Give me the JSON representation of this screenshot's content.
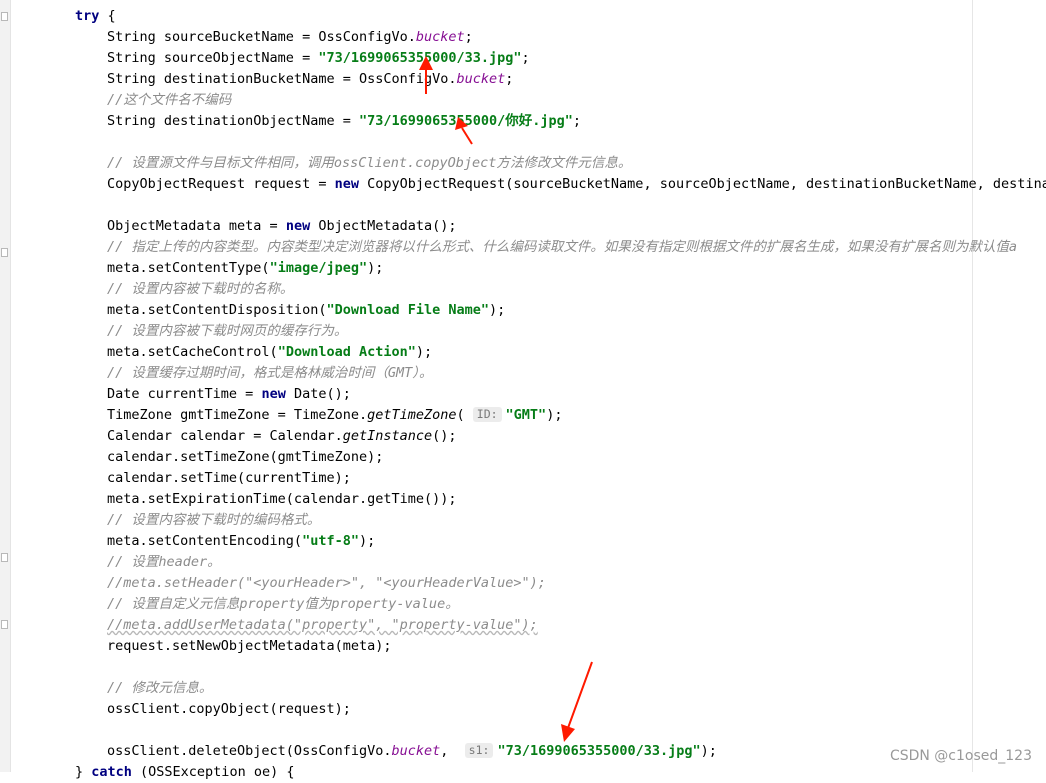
{
  "editor": {
    "top_line_fragment": "();  ... ( ... ) ... ) ... ));",
    "lines": [
      {
        "indent": 0,
        "t": [
          {
            "k": "kw",
            "v": "try"
          },
          {
            "v": " {"
          }
        ]
      },
      {
        "indent": 1,
        "t": [
          {
            "v": "String sourceBucketName = OssConfigVo."
          },
          {
            "k": "fld",
            "v": "bucket"
          },
          {
            "v": ";"
          }
        ]
      },
      {
        "indent": 1,
        "t": [
          {
            "v": "String sourceObjectName = "
          },
          {
            "k": "st",
            "v": "\"73/1699065355000/33.jpg\""
          },
          {
            "v": ";"
          }
        ]
      },
      {
        "indent": 1,
        "t": [
          {
            "v": "String destinationBucketName = OssConfigVo."
          },
          {
            "k": "fld",
            "v": "bucket"
          },
          {
            "v": ";"
          }
        ]
      },
      {
        "indent": 1,
        "t": [
          {
            "k": "cm",
            "v": "//这个文件名不编码"
          }
        ]
      },
      {
        "indent": 1,
        "t": [
          {
            "v": "String destinationObjectName = "
          },
          {
            "k": "st",
            "v": "\"73/1699065355000/你好.jpg\""
          },
          {
            "v": ";"
          }
        ]
      },
      {
        "indent": 1,
        "t": []
      },
      {
        "indent": 1,
        "t": [
          {
            "k": "cm",
            "v": "// 设置源文件与目标文件相同，调用ossClient.copyObject方法修改文件元信息。"
          }
        ]
      },
      {
        "indent": 1,
        "t": [
          {
            "v": "CopyObjectRequest request = "
          },
          {
            "k": "kw",
            "v": "new"
          },
          {
            "v": " CopyObjectRequest(sourceBucketName, sourceObjectName, destinationBucketName, destinati"
          }
        ]
      },
      {
        "indent": 1,
        "t": []
      },
      {
        "indent": 1,
        "t": [
          {
            "v": "ObjectMetadata meta = "
          },
          {
            "k": "kw",
            "v": "new"
          },
          {
            "v": " ObjectMetadata();"
          }
        ]
      },
      {
        "indent": 1,
        "t": [
          {
            "k": "cm",
            "v": "// 指定上传的内容类型。内容类型决定浏览器将以什么形式、什么编码读取文件。如果没有指定则根据文件的扩展名生成，如果没有扩展名则为默认值a"
          }
        ]
      },
      {
        "indent": 1,
        "t": [
          {
            "v": "meta.setContentType("
          },
          {
            "k": "st",
            "v": "\"image/jpeg\""
          },
          {
            "v": ");"
          }
        ]
      },
      {
        "indent": 1,
        "t": [
          {
            "k": "cm",
            "v": "// 设置内容被下载时的名称。"
          }
        ]
      },
      {
        "indent": 1,
        "t": [
          {
            "v": "meta.setContentDisposition("
          },
          {
            "k": "st",
            "v": "\"Download File Name\""
          },
          {
            "v": ");"
          }
        ]
      },
      {
        "indent": 1,
        "t": [
          {
            "k": "cm",
            "v": "// 设置内容被下载时网页的缓存行为。"
          }
        ]
      },
      {
        "indent": 1,
        "t": [
          {
            "v": "meta.setCacheControl("
          },
          {
            "k": "st",
            "v": "\"Download Action\""
          },
          {
            "v": ");"
          }
        ]
      },
      {
        "indent": 1,
        "t": [
          {
            "k": "cm",
            "v": "// 设置缓存过期时间，格式是格林威治时间（GMT）。"
          }
        ]
      },
      {
        "indent": 1,
        "t": [
          {
            "v": "Date currentTime = "
          },
          {
            "k": "kw",
            "v": "new"
          },
          {
            "v": " Date();"
          }
        ]
      },
      {
        "indent": 1,
        "t": [
          {
            "v": "TimeZone gmtTimeZone = TimeZone."
          },
          {
            "k": "mth",
            "v": "getTimeZone"
          },
          {
            "v": "( "
          },
          {
            "k": "hint",
            "v": "ID:"
          },
          {
            "k": "st",
            "v": "\"GMT\""
          },
          {
            "v": ");"
          }
        ]
      },
      {
        "indent": 1,
        "t": [
          {
            "v": "Calendar calendar = Calendar."
          },
          {
            "k": "mth",
            "v": "getInstance"
          },
          {
            "v": "();"
          }
        ]
      },
      {
        "indent": 1,
        "t": [
          {
            "v": "calendar.setTimeZone(gmtTimeZone);"
          }
        ]
      },
      {
        "indent": 1,
        "t": [
          {
            "v": "calendar.setTime(currentTime);"
          }
        ]
      },
      {
        "indent": 1,
        "t": [
          {
            "v": "meta.setExpirationTime(calendar.getTime());"
          }
        ]
      },
      {
        "indent": 1,
        "t": [
          {
            "k": "cm",
            "v": "// 设置内容被下载时的编码格式。"
          }
        ]
      },
      {
        "indent": 1,
        "t": [
          {
            "v": "meta.setContentEncoding("
          },
          {
            "k": "st",
            "v": "\"utf-8\""
          },
          {
            "v": ");"
          }
        ]
      },
      {
        "indent": 1,
        "t": [
          {
            "k": "cm",
            "v": "// 设置header。"
          }
        ]
      },
      {
        "indent": 1,
        "t": [
          {
            "k": "cm",
            "v": "//meta.setHeader(\"<yourHeader>\", \"<yourHeaderValue>\");"
          }
        ]
      },
      {
        "indent": 1,
        "t": [
          {
            "k": "cm",
            "v": "// 设置自定义元信息property值为property-value。"
          }
        ]
      },
      {
        "indent": 1,
        "t": [
          {
            "k": "cm squig",
            "v": "//meta.addUserMetadata(\"property\", \"property-value\");"
          }
        ]
      },
      {
        "indent": 1,
        "t": [
          {
            "v": "request.setNewObjectMetadata(meta);"
          }
        ]
      },
      {
        "indent": 1,
        "t": []
      },
      {
        "indent": 1,
        "t": [
          {
            "k": "cm",
            "v": "// 修改元信息。"
          }
        ]
      },
      {
        "indent": 1,
        "t": [
          {
            "v": "ossClient.copyObject(request);"
          }
        ]
      },
      {
        "indent": 1,
        "t": []
      },
      {
        "indent": 1,
        "t": [
          {
            "v": "ossClient.deleteObject(OssConfigVo."
          },
          {
            "k": "fld",
            "v": "bucket"
          },
          {
            "v": ",  "
          },
          {
            "k": "hint",
            "v": "s1:"
          },
          {
            "k": "st",
            "v": "\"73/1699065355000/33.jpg\""
          },
          {
            "v": ");"
          }
        ]
      },
      {
        "indent": 0,
        "t": [
          {
            "v": "} "
          },
          {
            "k": "kw",
            "v": "catch"
          },
          {
            "v": " (OSSException oe) {"
          }
        ]
      }
    ]
  },
  "watermark": "CSDN @c1osed_123",
  "colors": {
    "keyword": "#000080",
    "string": "#067d17",
    "field": "#871094",
    "comment": "#8c8c8c",
    "arrow": "#ff1a00"
  }
}
